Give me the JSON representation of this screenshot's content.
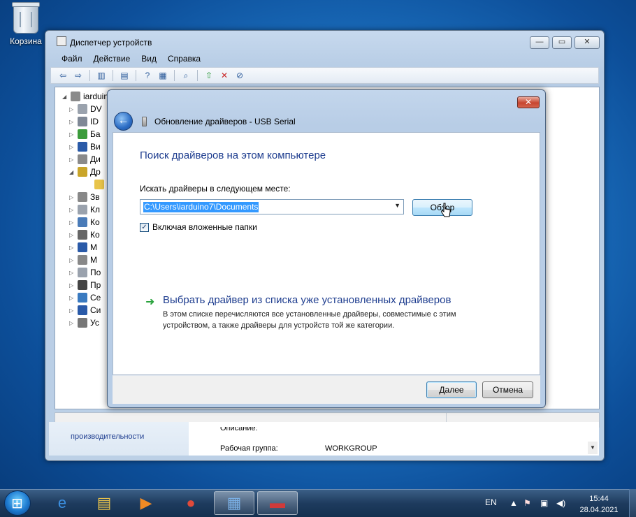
{
  "desktop": {
    "recycle_bin_label": "Корзина"
  },
  "device_manager": {
    "title": "Диспетчер устройств",
    "menu": [
      "Файл",
      "Действие",
      "Вид",
      "Справка"
    ],
    "tree": [
      {
        "label": "iarduin",
        "expand": "◢",
        "icon_color": "#8a8a8a",
        "icon": "computer-icon"
      },
      {
        "label": "DV",
        "expand": "▷",
        "icon_color": "#9aa2ad",
        "icon": "dvd-drive-icon"
      },
      {
        "label": "ID",
        "expand": "▷",
        "icon_color": "#7f8896",
        "icon": "ide-controller-icon"
      },
      {
        "label": "Ба",
        "expand": "▷",
        "icon_color": "#3b9b3b",
        "icon": "battery-icon"
      },
      {
        "label": "Ви",
        "expand": "▷",
        "icon_color": "#2a5aa8",
        "icon": "video-adapter-icon"
      },
      {
        "label": "Ди",
        "expand": "▷",
        "icon_color": "#8a8a8a",
        "icon": "disk-drive-icon"
      },
      {
        "label": "Др",
        "expand": "◢",
        "icon_color": "#c9a52a",
        "icon": "other-devices-icon"
      },
      {
        "label": "",
        "expand": "",
        "icon_color": "#e8c44a",
        "icon": "unknown-device-icon"
      },
      {
        "label": "Зв",
        "expand": "▷",
        "icon_color": "#888888",
        "icon": "sound-icon"
      },
      {
        "label": "Кл",
        "expand": "▷",
        "icon_color": "#9aa2ad",
        "icon": "keyboard-icon"
      },
      {
        "label": "Ко",
        "expand": "▷",
        "icon_color": "#4a7bb8",
        "icon": "computer-icon"
      },
      {
        "label": "Ко",
        "expand": "▷",
        "icon_color": "#666666",
        "icon": "usb-controller-icon"
      },
      {
        "label": "М",
        "expand": "▷",
        "icon_color": "#2a5aa8",
        "icon": "monitor-icon"
      },
      {
        "label": "М",
        "expand": "▷",
        "icon_color": "#888888",
        "icon": "mouse-icon"
      },
      {
        "label": "По",
        "expand": "▷",
        "icon_color": "#9aa2ad",
        "icon": "port-icon"
      },
      {
        "label": "Пр",
        "expand": "▷",
        "icon_color": "#444444",
        "icon": "processor-icon"
      },
      {
        "label": "Се",
        "expand": "▷",
        "icon_color": "#3a7ac0",
        "icon": "network-adapter-icon"
      },
      {
        "label": "Си",
        "expand": "▷",
        "icon_color": "#2a5aa8",
        "icon": "system-devices-icon"
      },
      {
        "label": "Ус",
        "expand": "▷",
        "icon_color": "#777777",
        "icon": "hid-icon"
      }
    ]
  },
  "system_window": {
    "left_link": "производительности",
    "partial_label": "Описание:",
    "workgroup_label": "Рабочая группа:",
    "workgroup_value": "WORKGROUP"
  },
  "dialog": {
    "title": "Обновление драйверов - USB Serial",
    "close_glyph": "✕",
    "heading": "Поиск драйверов на этом компьютере",
    "search_label": "Искать драйверы в следующем месте:",
    "path_value": "C:\\Users\\iarduino7\\Documents",
    "browse_button": "Обзор",
    "include_subfolders": "Включая вложенные папки",
    "include_subfolders_checked": true,
    "pick_link": "Выбрать драйвер из списка уже установленных драйверов",
    "pick_desc": "В этом списке перечисляются все установленные драйверы, совместимые с этим устройством, а также драйверы для устройств той же категории.",
    "next_button": "Далее",
    "cancel_button": "Отмена"
  },
  "taskbar": {
    "apps": [
      {
        "name": "internet-explorer",
        "glyph": "e",
        "color": "#3b8fe0"
      },
      {
        "name": "file-explorer",
        "glyph": "▤",
        "color": "#e8c24a"
      },
      {
        "name": "media-player",
        "glyph": "▶",
        "color": "#f08a24"
      },
      {
        "name": "chrome",
        "glyph": "●",
        "color": "#e04a3a"
      },
      {
        "name": "control-panel",
        "glyph": "▦",
        "color": "#7ab0e6"
      },
      {
        "name": "toolbox",
        "glyph": "▬",
        "color": "#d03a3a"
      }
    ],
    "language": "EN",
    "time": "15:44",
    "date": "28.04.2021"
  }
}
